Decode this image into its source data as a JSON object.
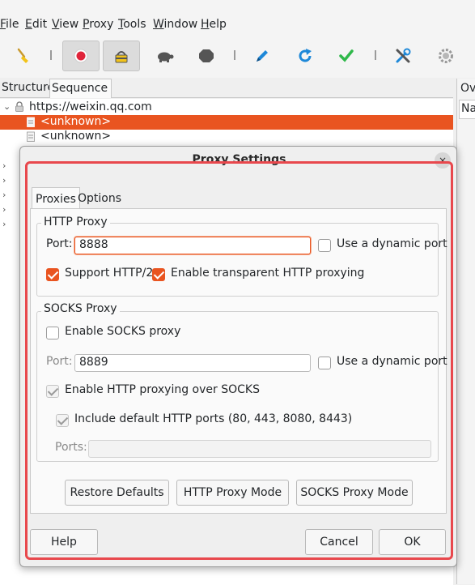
{
  "menu": [
    "File",
    "Edit",
    "View",
    "Proxy",
    "Tools",
    "Window",
    "Help"
  ],
  "toolbar": {
    "icons": [
      "clear-icon",
      "record-icon",
      "ssl-proxying-icon",
      "throttle-icon",
      "breakpoints-icon",
      "compose-icon",
      "repeat-icon",
      "validate-icon",
      "tools-icon",
      "settings-icon"
    ]
  },
  "left_panel": {
    "tabs": [
      "Structure",
      "Sequence"
    ],
    "tree": {
      "host": "https://weixin.qq.com",
      "children": [
        "<unknown>",
        "<unknown>"
      ]
    }
  },
  "right_panel": {
    "tab_partial": "Ov",
    "field_partial": "Na"
  },
  "dialog": {
    "title": "Proxy Settings",
    "close_glyph": "×",
    "tabs": [
      "Proxies",
      "Options"
    ],
    "http_proxy": {
      "title": "HTTP Proxy",
      "port_label": "Port:",
      "port_value": "8888",
      "dynamic_port_label": "Use a dynamic port",
      "dynamic_port_checked": false,
      "http2_label": "Support HTTP/2",
      "http2_checked": true,
      "transparent_label": "Enable transparent HTTP proxying",
      "transparent_checked": true
    },
    "socks_proxy": {
      "title": "SOCKS Proxy",
      "enable_label": "Enable SOCKS proxy",
      "enable_checked": false,
      "port_label": "Port:",
      "port_value": "8889",
      "dynamic_port_label": "Use a dynamic port",
      "dynamic_port_checked": false,
      "http_over_socks_label": "Enable HTTP proxying over SOCKS",
      "http_over_socks_checked": true,
      "default_ports_label": "Include default HTTP ports (80, 443, 8080, 8443)",
      "default_ports_checked": true,
      "ports_label": "Ports:",
      "ports_value": ""
    },
    "buttons": {
      "restore_defaults": "Restore Defaults",
      "http_proxy_mode": "HTTP Proxy Mode",
      "socks_proxy_mode": "SOCKS Proxy Mode",
      "help": "Help",
      "cancel": "Cancel",
      "ok": "OK"
    }
  },
  "colors": {
    "accent": "#e95420",
    "focus_ring": "#e8484d",
    "record": "#e0243a",
    "repeat": "#1e88d8",
    "validate": "#2fb84a"
  }
}
